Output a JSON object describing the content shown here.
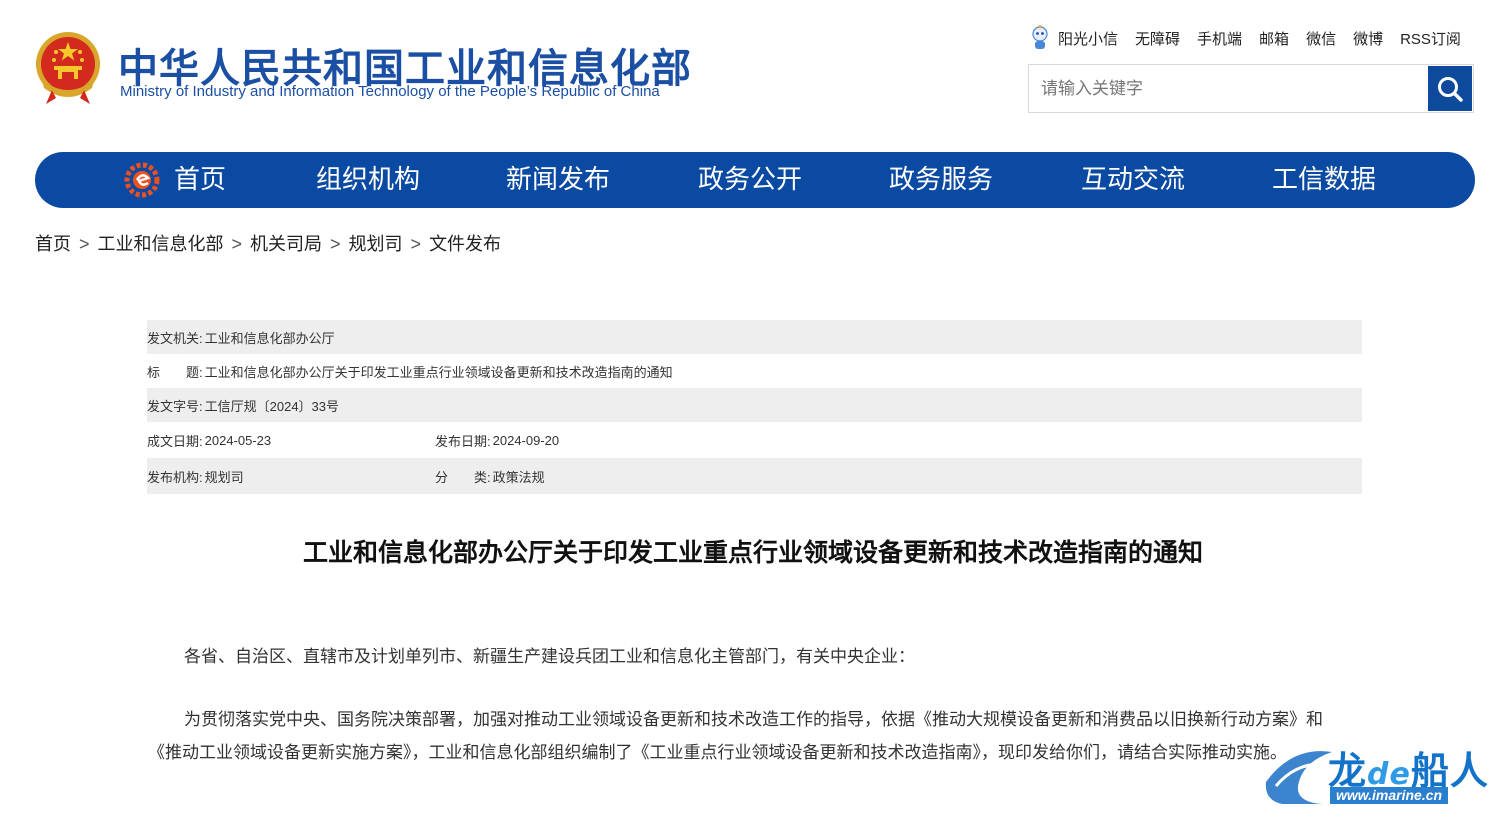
{
  "header": {
    "title": "中华人民共和国工业和信息化部",
    "subtitle": "Ministry of Industry and Information Technology of the People’s Republic of China",
    "toplinks": [
      "阳光小信",
      "无障碍",
      "手机端",
      "邮箱",
      "微信",
      "微博",
      "RSS订阅"
    ],
    "search_placeholder": "请输入关键字"
  },
  "nav": {
    "items": [
      "首页",
      "组织机构",
      "新闻发布",
      "政务公开",
      "政务服务",
      "互动交流",
      "工信数据"
    ]
  },
  "breadcrumb": [
    "首页",
    "工业和信息化部",
    "机关司局",
    "规划司",
    "文件发布"
  ],
  "meta": {
    "issuer_label": "发文机关:",
    "issuer": "工业和信息化部办公厅",
    "title_label": "标　　题:",
    "title": "工业和信息化部办公厅关于印发工业重点行业领域设备更新和技术改造指南的通知",
    "docno_label": "发文字号:",
    "docno": "工信厅规〔2024〕33号",
    "created_label": "成文日期:",
    "created": "2024-05-23",
    "published_label": "发布日期:",
    "published": "2024-09-20",
    "org_label": "发布机构:",
    "org": "规划司",
    "category_label": "分　　类:",
    "category": "政策法规"
  },
  "article": {
    "title": "工业和信息化部办公厅关于印发工业重点行业领域设备更新和技术改造指南的通知",
    "para1": "各省、自治区、直辖市及计划单列市、新疆生产建设兵团工业和信息化主管部门，有关中央企业：",
    "para2": "为贯彻落实党中央、国务院决策部署，加强对推动工业领域设备更新和技术改造工作的指导，依据《推动大规模设备更新和消费品以旧换新行动方案》和《推动工业领域设备更新实施方案》，工业和信息化部组织编制了《工业重点行业领域设备更新和技术改造指南》，现印发给你们，请结合实际推动实施。"
  },
  "watermark": {
    "brand_a": "龙",
    "brand_b": "de",
    "brand_c": "船人",
    "url": "www.imarine.cn"
  },
  "colors": {
    "brand_blue": "#1b4fa3",
    "nav_blue": "#0b4aa2",
    "search_btn": "#0d4a9c",
    "meta_shade": "#eeeeee"
  }
}
